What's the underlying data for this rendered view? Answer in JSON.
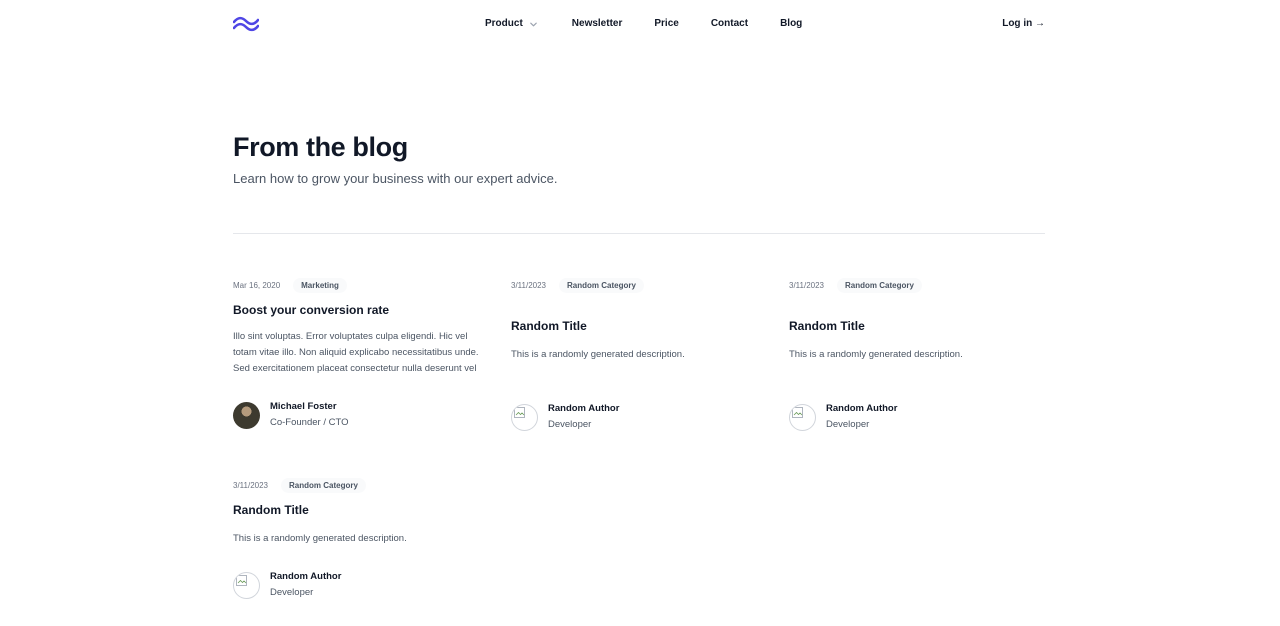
{
  "nav": {
    "logo_icon": "tailwind-waves-logo",
    "logo_color": "#4f46e5",
    "items": [
      {
        "label": "Product",
        "icon": "chevron-down-icon"
      },
      {
        "label": "Newsletter"
      },
      {
        "label": "Price"
      },
      {
        "label": "Contact"
      },
      {
        "label": "Blog"
      }
    ],
    "login": "Log in →"
  },
  "hero": {
    "title": "From the blog",
    "subtitle": "Learn how to grow your business with our expert advice."
  },
  "posts": [
    {
      "date": "Mar 16, 2020",
      "category": "Marketing",
      "title": "Boost your conversion rate",
      "description": "Illo sint voluptas. Error voluptates culpa eligendi. Hic vel totam vitae illo. Non aliquid explicabo necessitatibus unde. Sed exercitationem placeat consectetur nulla deserunt vel iusto corrupti dicta laboris incididunt.",
      "author": {
        "name": "Michael Foster",
        "role": "Co-Founder / CTO"
      }
    },
    {
      "date": "3/11/2023",
      "category": "Random Category",
      "title": "Random Title",
      "description": "This is a randomly generated description.",
      "author": {
        "name": "Random Author",
        "role": "Developer"
      }
    },
    {
      "date": "3/11/2023",
      "category": "Random Category",
      "title": "Random Title",
      "description": "This is a randomly generated description.",
      "author": {
        "name": "Random Author",
        "role": "Developer"
      }
    },
    {
      "date": "3/11/2023",
      "category": "Random Category",
      "title": "Random Title",
      "description": "This is a randomly generated description.",
      "author": {
        "name": "Random Author",
        "role": "Developer"
      }
    }
  ]
}
